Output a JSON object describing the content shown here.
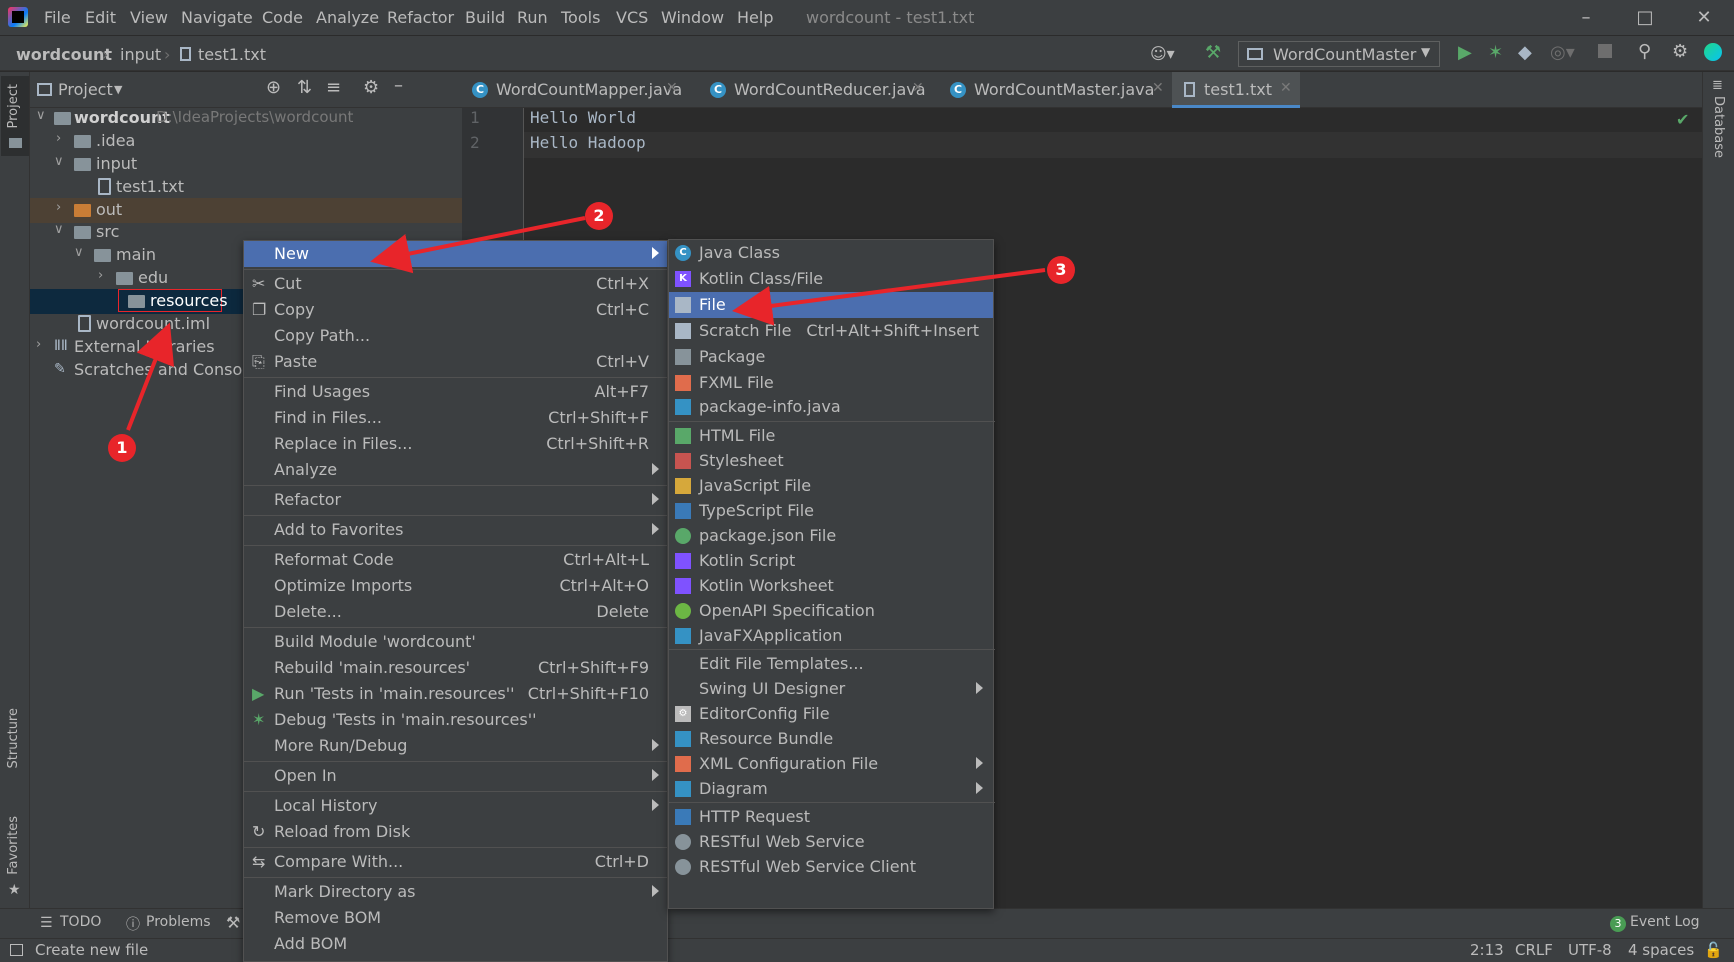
{
  "app": {
    "window_title": "wordcount - test1.txt",
    "menu": [
      "File",
      "Edit",
      "View",
      "Navigate",
      "Code",
      "Analyze",
      "Refactor",
      "Build",
      "Run",
      "Tools",
      "VCS",
      "Window",
      "Help"
    ]
  },
  "breadcrumb": [
    "wordcount",
    "input",
    "test1.txt"
  ],
  "run_config": "WordCountMaster",
  "project_panel": {
    "title": "Project",
    "tree": [
      {
        "label": "wordcount",
        "path": "D:\\IdeaProjects\\wordcount"
      },
      {
        "label": ".idea"
      },
      {
        "label": "input"
      },
      {
        "label": "test1.txt"
      },
      {
        "label": "out"
      },
      {
        "label": "src"
      },
      {
        "label": "main"
      },
      {
        "label": "edu"
      },
      {
        "label": "resources"
      },
      {
        "label": "wordcount.iml"
      },
      {
        "label": "External Libraries"
      },
      {
        "label": "Scratches and Consoles"
      }
    ]
  },
  "tabs": [
    "WordCountMapper.java",
    "WordCountReducer.java",
    "WordCountMaster.java",
    "test1.txt"
  ],
  "editor": {
    "line_numbers": [
      "1",
      "2"
    ],
    "lines": [
      "Hello World",
      "Hello Hadoop"
    ]
  },
  "side_tabs": {
    "project": "Project",
    "structure": "Structure",
    "favorites": "Favorites",
    "database": "Database"
  },
  "context_menu": [
    {
      "label": "New",
      "shortcut": ""
    },
    {
      "label": "Cut",
      "shortcut": "Ctrl+X"
    },
    {
      "label": "Copy",
      "shortcut": "Ctrl+C"
    },
    {
      "label": "Copy Path...",
      "shortcut": ""
    },
    {
      "label": "Paste",
      "shortcut": "Ctrl+V"
    },
    {
      "label": "Find Usages",
      "shortcut": "Alt+F7"
    },
    {
      "label": "Find in Files...",
      "shortcut": "Ctrl+Shift+F"
    },
    {
      "label": "Replace in Files...",
      "shortcut": "Ctrl+Shift+R"
    },
    {
      "label": "Analyze",
      "shortcut": ""
    },
    {
      "label": "Refactor",
      "shortcut": ""
    },
    {
      "label": "Add to Favorites",
      "shortcut": ""
    },
    {
      "label": "Reformat Code",
      "shortcut": "Ctrl+Alt+L"
    },
    {
      "label": "Optimize Imports",
      "shortcut": "Ctrl+Alt+O"
    },
    {
      "label": "Delete...",
      "shortcut": "Delete"
    },
    {
      "label": "Build Module 'wordcount'",
      "shortcut": ""
    },
    {
      "label": "Rebuild 'main.resources'",
      "shortcut": "Ctrl+Shift+F9"
    },
    {
      "label": "Run 'Tests in 'main.resources''",
      "shortcut": "Ctrl+Shift+F10"
    },
    {
      "label": "Debug 'Tests in 'main.resources''",
      "shortcut": ""
    },
    {
      "label": "More Run/Debug",
      "shortcut": ""
    },
    {
      "label": "Open In",
      "shortcut": ""
    },
    {
      "label": "Local History",
      "shortcut": ""
    },
    {
      "label": "Reload from Disk",
      "shortcut": ""
    },
    {
      "label": "Compare With...",
      "shortcut": "Ctrl+D"
    },
    {
      "label": "Mark Directory as",
      "shortcut": ""
    },
    {
      "label": "Remove BOM",
      "shortcut": ""
    },
    {
      "label": "Add BOM",
      "shortcut": ""
    }
  ],
  "new_submenu": [
    {
      "label": "Java Class",
      "shortcut": ""
    },
    {
      "label": "Kotlin Class/File",
      "shortcut": ""
    },
    {
      "label": "File",
      "shortcut": ""
    },
    {
      "label": "Scratch File",
      "shortcut": "Ctrl+Alt+Shift+Insert"
    },
    {
      "label": "Package",
      "shortcut": ""
    },
    {
      "label": "FXML File",
      "shortcut": ""
    },
    {
      "label": "package-info.java",
      "shortcut": ""
    },
    {
      "label": "HTML File",
      "shortcut": ""
    },
    {
      "label": "Stylesheet",
      "shortcut": ""
    },
    {
      "label": "JavaScript File",
      "shortcut": ""
    },
    {
      "label": "TypeScript File",
      "shortcut": ""
    },
    {
      "label": "package.json File",
      "shortcut": ""
    },
    {
      "label": "Kotlin Script",
      "shortcut": ""
    },
    {
      "label": "Kotlin Worksheet",
      "shortcut": ""
    },
    {
      "label": "OpenAPI Specification",
      "shortcut": ""
    },
    {
      "label": "JavaFXApplication",
      "shortcut": ""
    },
    {
      "label": "Edit File Templates...",
      "shortcut": ""
    },
    {
      "label": "Swing UI Designer",
      "shortcut": ""
    },
    {
      "label": "EditorConfig File",
      "shortcut": ""
    },
    {
      "label": "Resource Bundle",
      "shortcut": ""
    },
    {
      "label": "XML Configuration File",
      "shortcut": ""
    },
    {
      "label": "Diagram",
      "shortcut": ""
    },
    {
      "label": "HTTP Request",
      "shortcut": ""
    },
    {
      "label": "RESTful Web Service",
      "shortcut": ""
    },
    {
      "label": "RESTful Web Service Client",
      "shortcut": ""
    }
  ],
  "bottom_tools": {
    "todo": "TODO",
    "problems": "Problems",
    "event_log": "Event Log",
    "event_count": "3"
  },
  "status": {
    "message": "Create new file",
    "position": "2:13",
    "line_sep": "CRLF",
    "encoding": "UTF-8",
    "indent": "4 spaces"
  },
  "annotations": [
    "1",
    "2",
    "3"
  ],
  "colors": {
    "selection": "#4b6eaf",
    "annotation": "#e8252a",
    "panel": "#3c3f41",
    "editor": "#2b2b2b"
  }
}
